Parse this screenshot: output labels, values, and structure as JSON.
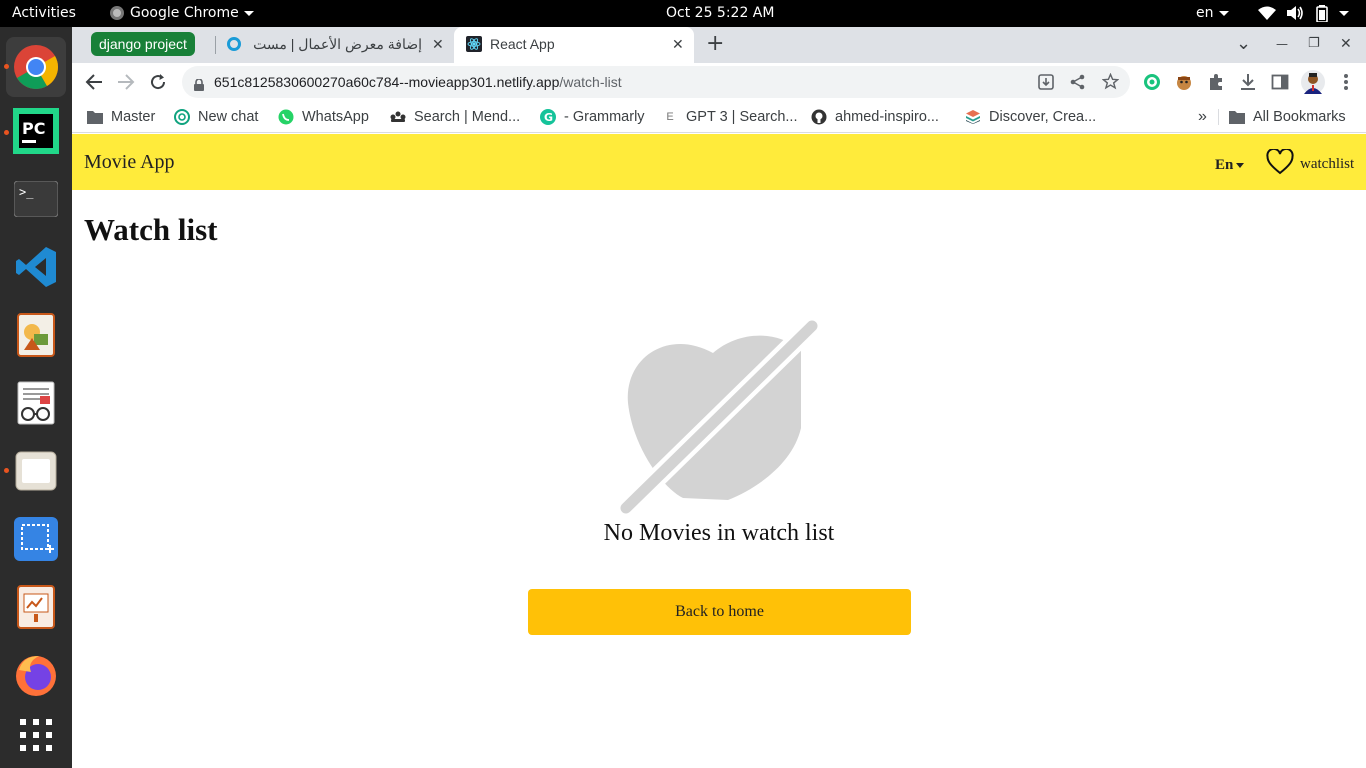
{
  "system_bar": {
    "activities": "Activities",
    "app_name": "Google Chrome",
    "datetime": "Oct 25  5:22 AM",
    "input_lang": "en"
  },
  "dock": {
    "items": [
      "chrome-icon",
      "pycharm-icon",
      "terminal-icon",
      "vscode-icon",
      "draw-icon",
      "document-viewer-icon",
      "files-icon",
      "screenshot-icon",
      "impress-icon",
      "firefox-icon",
      "app-grid-icon"
    ]
  },
  "tabs": {
    "group_label": "django project",
    "items": [
      {
        "title": "إضافة معرض الأعمال | مست",
        "active": false
      },
      {
        "title": "React App",
        "active": true
      }
    ],
    "close_glyph": "✕",
    "new_tab": "+"
  },
  "window_controls": {
    "menu": "⌄",
    "minimize": "—",
    "restore": "❐",
    "close": "✕"
  },
  "omnibox": {
    "host": "651c8125830600270a60c784--movieapp301.netlify.app",
    "path": "/watch-list"
  },
  "bookmarks": {
    "items": [
      {
        "label": "Master",
        "icon": "folder-icon"
      },
      {
        "label": "New chat",
        "icon": "openai-icon"
      },
      {
        "label": "WhatsApp",
        "icon": "whatsapp-icon"
      },
      {
        "label": "Search | Mend...",
        "icon": "mendeley-icon"
      },
      {
        "label": "- Grammarly",
        "icon": "grammarly-icon"
      },
      {
        "label": "GPT 3 | Search...",
        "icon": "gpt-icon"
      },
      {
        "label": "ahmed-inspiro...",
        "icon": "github-icon"
      },
      {
        "label": "Discover, Crea...",
        "icon": "layers-icon"
      }
    ],
    "overflow": "»",
    "all_bookmarks": "All Bookmarks"
  },
  "app": {
    "brand": "Movie App",
    "language": "En",
    "watchlist_link": "watchlist",
    "heading": "Watch list",
    "empty_message": "No Movies in watch list",
    "back_button": "Back to home"
  },
  "colors": {
    "navbar": "#ffeb3b",
    "button": "#ffc107",
    "illustration": "#d3d3d3",
    "tab_group": "#188038"
  }
}
